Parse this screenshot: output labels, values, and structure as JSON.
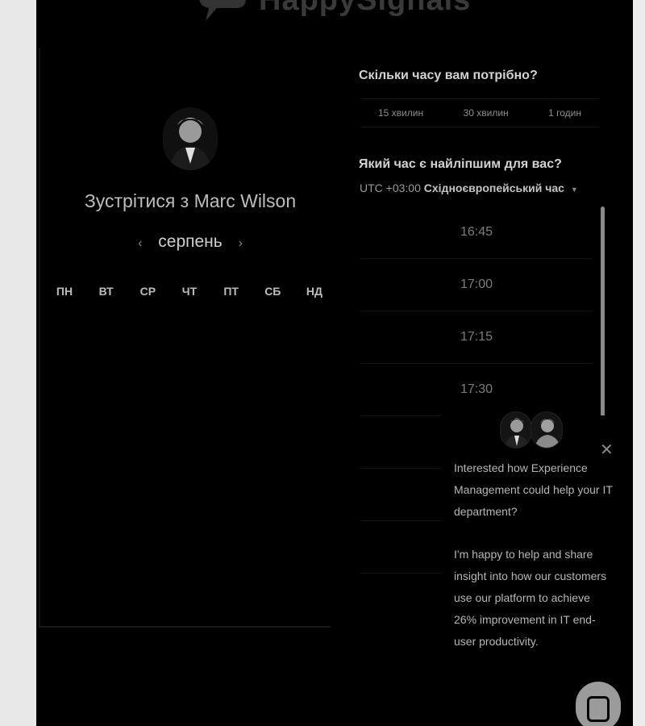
{
  "brand": {
    "name": "HappySignals"
  },
  "booking": {
    "meet_title": "Зустрітися з Marc Wilson",
    "month": "серпень",
    "weekdays": [
      "ПН",
      "ВТ",
      "СР",
      "ЧТ",
      "ПТ",
      "СБ",
      "НД"
    ]
  },
  "duration": {
    "question": "Скільки часу вам потрібно?",
    "options": [
      "15 хвилин",
      "30 хвилин",
      "1 годин"
    ]
  },
  "time": {
    "question": "Який час є найліпшим для вас?",
    "tz_offset": "UTC +03:00",
    "tz_name": "Східноєвропейський час",
    "slots": [
      "16:45",
      "17:00",
      "17:15",
      "17:30",
      "",
      "",
      "",
      ""
    ]
  },
  "chat": {
    "message_1": "Interested how Experience Management could help your IT department?",
    "message_2": "I'm happy to help and share insight into how our customers use our platform to achieve 26% improvement in IT end-user productivity."
  }
}
